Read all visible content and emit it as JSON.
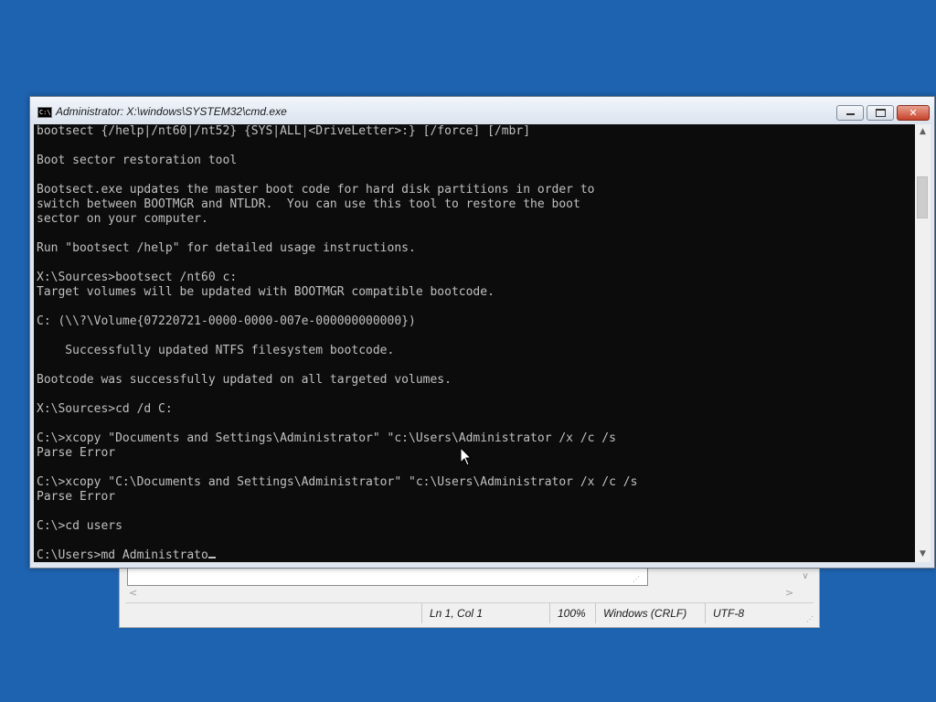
{
  "window": {
    "title": "Administrator: X:\\windows\\SYSTEM32\\cmd.exe",
    "icon_label": "C:\\"
  },
  "console": {
    "lines": [
      "bootsect {/help|/nt60|/nt52} {SYS|ALL|<DriveLetter>:} [/force] [/mbr]",
      "",
      "Boot sector restoration tool",
      "",
      "Bootsect.exe updates the master boot code for hard disk partitions in order to",
      "switch between BOOTMGR and NTLDR.  You can use this tool to restore the boot",
      "sector on your computer.",
      "",
      "Run \"bootsect /help\" for detailed usage instructions.",
      "",
      "X:\\Sources>bootsect /nt60 c:",
      "Target volumes will be updated with BOOTMGR compatible bootcode.",
      "",
      "C: (\\\\?\\Volume{07220721-0000-0000-007e-000000000000})",
      "",
      "    Successfully updated NTFS filesystem bootcode.",
      "",
      "Bootcode was successfully updated on all targeted volumes.",
      "",
      "X:\\Sources>cd /d C:",
      "",
      "C:\\>xcopy \"Documents and Settings\\Administrator\" \"c:\\Users\\Administrator /x /c /s",
      "Parse Error",
      "",
      "C:\\>xcopy \"C:\\Documents and Settings\\Administrator\" \"c:\\Users\\Administrator /x /c /s",
      "Parse Error",
      "",
      "C:\\>cd users",
      "",
      "C:\\Users>md Administrato"
    ]
  },
  "notepad": {
    "status": {
      "position": "Ln 1, Col 1",
      "zoom": "100%",
      "line_endings": "Windows (CRLF)",
      "encoding": "UTF-8"
    }
  },
  "colors": {
    "desktop": "#1e63b0",
    "console_bg": "#0c0c0c",
    "console_fg": "#c0c0c0",
    "close_button": "#c7422a"
  },
  "icons": [
    "cmd-icon",
    "minimize-icon",
    "maximize-icon",
    "close-icon",
    "chevron-up-icon",
    "chevron-down-icon",
    "mouse-pointer-icon"
  ]
}
